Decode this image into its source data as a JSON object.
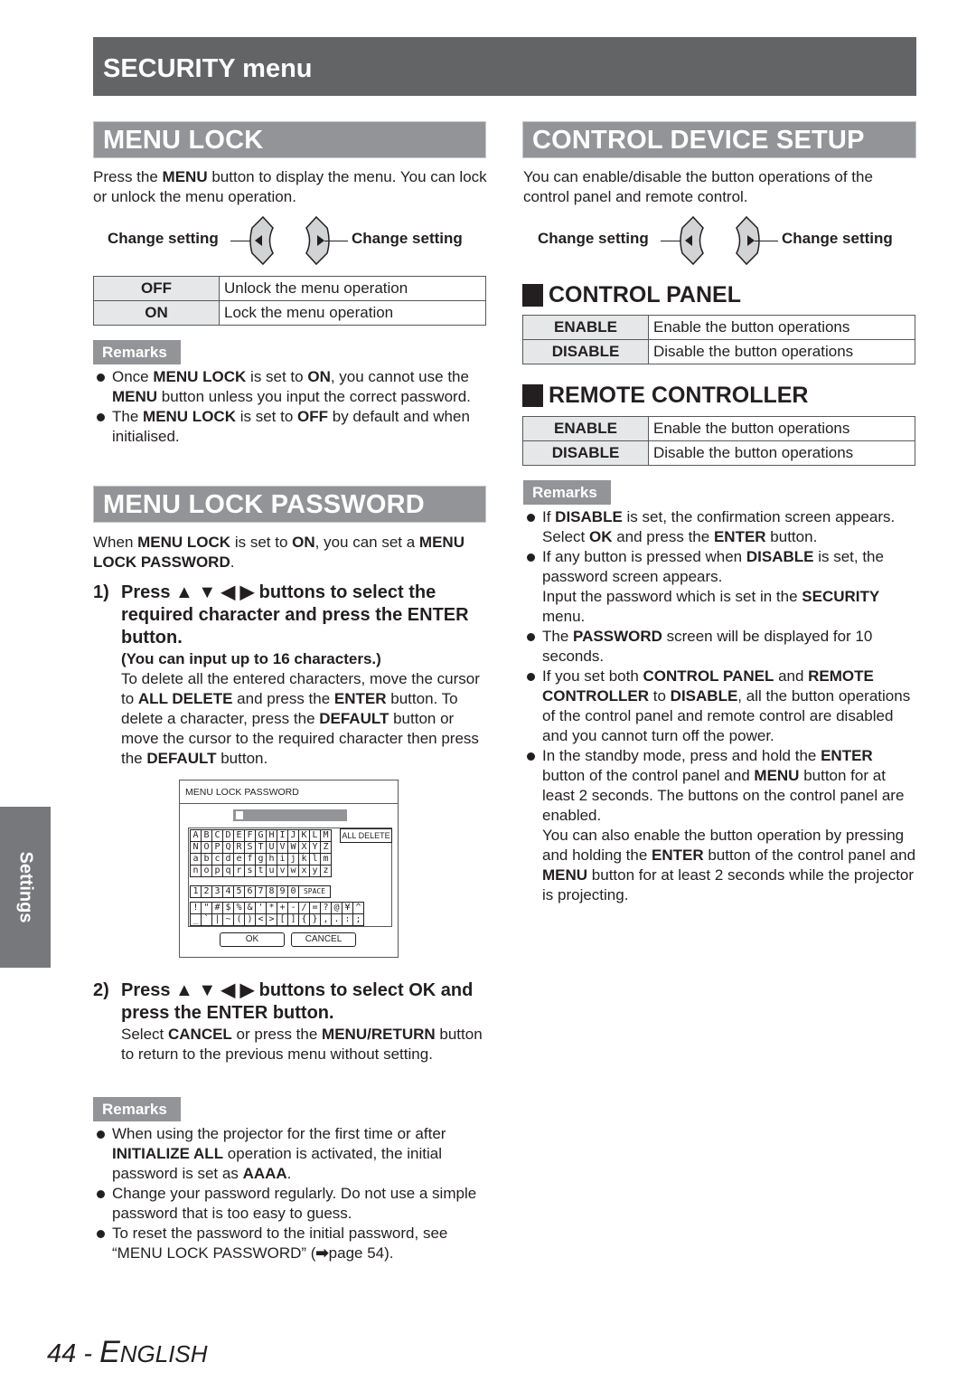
{
  "page_header": "SECURITY menu",
  "side_tab": "Settings",
  "footer": {
    "page_number": "44",
    "separator": "-",
    "language_initial": "E",
    "language_rest": "NGLISH"
  },
  "change_setting": {
    "left_label": "Change setting",
    "right_label": "Change setting",
    "left_icon": "left-arrow-button-icon",
    "right_icon": "right-arrow-button-icon"
  },
  "menu_lock": {
    "title": "MENU LOCK",
    "intro": [
      "Press the ",
      "MENU",
      " button to display the menu. You can lock or unlock the menu operation."
    ],
    "options": [
      {
        "key": "OFF",
        "desc": "Unlock the menu operation"
      },
      {
        "key": "ON",
        "desc": "Lock the menu operation"
      }
    ],
    "remarks_label": "Remarks",
    "remarks": [
      [
        "Once ",
        "MENU LOCK",
        " is set to ",
        "ON",
        ", you cannot use the ",
        "MENU",
        " button unless you input the correct password."
      ],
      [
        "The ",
        "MENU LOCK",
        " is set to ",
        "OFF",
        " by default and when initialised."
      ]
    ]
  },
  "menu_lock_password": {
    "title": "MENU LOCK PASSWORD",
    "intro": [
      "When ",
      "MENU LOCK",
      " is set to ",
      "ON",
      ", you can set a ",
      "MENU LOCK PASSWORD",
      "."
    ],
    "step1": {
      "num": "1)",
      "title": "Press ▲ ▼ ◀ ▶ buttons to select the required character and press the ENTER button.",
      "note": "(You can input up to 16 characters.)",
      "body": [
        "To delete all the entered characters, move the cursor to ",
        "ALL DELETE",
        " and press the ",
        "ENTER",
        " button. To delete a character, press the ",
        "DEFAULT",
        " button or move the cursor to the required character then press the ",
        "DEFAULT",
        " button."
      ]
    },
    "osd": {
      "title": "MENU LOCK PASSWORD",
      "all_delete": "ALL DELETE",
      "rows_upper": [
        "ABCDEFGHIJKLM",
        "NOPQRSTUVWXYZ"
      ],
      "rows_lower": [
        "abcdefghijklm",
        "nopqrstuvwxyz"
      ],
      "digits": "1234567890",
      "space": "SPACE",
      "symbols1": [
        "!",
        "\"",
        "#",
        "$",
        "%",
        "&",
        "'",
        "*",
        "+",
        "-",
        "/",
        "=",
        "?",
        "@",
        "¥",
        "^"
      ],
      "symbols2": [
        "_",
        "`",
        "|",
        "~",
        "(",
        ")",
        "<",
        ">",
        "[",
        "]",
        "{",
        "}",
        ",",
        ".",
        ":",
        ";"
      ],
      "ok": "OK",
      "cancel": "CANCEL"
    },
    "step2": {
      "num": "2)",
      "title": "Press ▲ ▼ ◀ ▶ buttons to select OK and press the ENTER button.",
      "body": [
        "Select ",
        "CANCEL",
        " or press the ",
        "MENU/RETURN",
        " button to return to the previous menu without setting."
      ]
    },
    "remarks_label": "Remarks",
    "remarks": [
      [
        "When using the projector for the first time or after ",
        "INITIALIZE ALL",
        " operation is activated, the initial password is set as ",
        "AAAA",
        "."
      ],
      [
        "Change your password regularly. Do not use a simple password that is too easy to guess."
      ],
      [
        "To reset the password to the initial password, see “MENU LOCK PASSWORD” (",
        "➡",
        "page 54)."
      ]
    ]
  },
  "control_device_setup": {
    "title": "CONTROL DEVICE SETUP",
    "intro": "You can enable/disable the button operations of the control panel and remote control.",
    "control_panel": {
      "title": "CONTROL PANEL",
      "options": [
        {
          "key": "ENABLE",
          "desc": "Enable the button operations"
        },
        {
          "key": "DISABLE",
          "desc": "Disable the button operations"
        }
      ]
    },
    "remote_controller": {
      "title": "REMOTE CONTROLLER",
      "options": [
        {
          "key": "ENABLE",
          "desc": "Enable the button operations"
        },
        {
          "key": "DISABLE",
          "desc": "Disable the button operations"
        }
      ]
    },
    "remarks_label": "Remarks",
    "remarks": [
      {
        "parts": [
          "If ",
          "DISABLE",
          " is set, the confirmation screen appears. Select ",
          "OK",
          " and press the ",
          "ENTER",
          " button."
        ]
      },
      {
        "parts": [
          "If any button is pressed when ",
          "DISABLE",
          " is set, the password screen appears."
        ],
        "cont": [
          "Input the password which is set in the ",
          "SECURITY",
          " menu."
        ]
      },
      {
        "parts": [
          "The ",
          "PASSWORD",
          " screen will be displayed for 10 seconds."
        ]
      },
      {
        "parts": [
          "If you set both ",
          "CONTROL PANEL",
          " and ",
          "REMOTE CONTROLLER",
          " to ",
          "DISABLE",
          ", all the button operations of the control panel and remote control are disabled and you cannot turn off the power."
        ]
      },
      {
        "parts": [
          "In the standby mode, press and hold the ",
          "ENTER",
          " button of the control panel and ",
          "MENU",
          " button for at least 2 seconds. The buttons on the control panel are enabled."
        ],
        "cont": [
          "You can also enable the button operation by pressing and holding the ",
          "ENTER",
          " button of the control panel and ",
          "MENU",
          " button for at least 2 seconds while the projector is projecting."
        ]
      }
    ]
  }
}
